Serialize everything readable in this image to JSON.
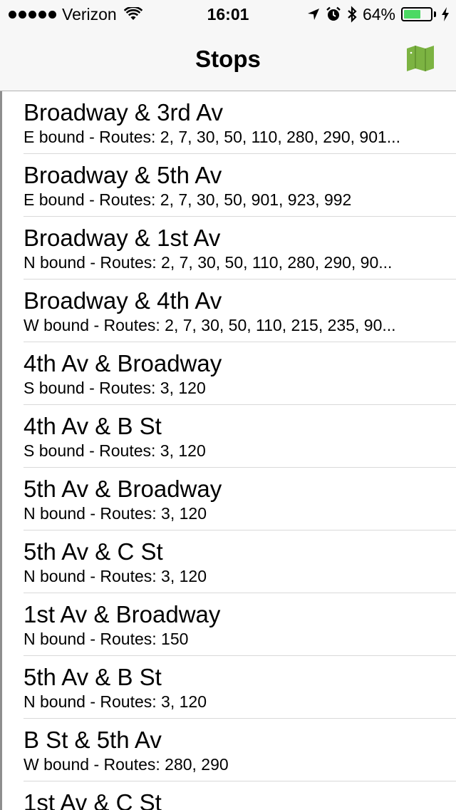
{
  "status_bar": {
    "carrier": "Verizon",
    "time": "16:01",
    "battery_percent_label": "64%",
    "battery_level": 0.64,
    "icons": [
      "signal-dots-icon",
      "wifi-icon",
      "location-arrow-icon",
      "alarm-icon",
      "bluetooth-icon",
      "battery-icon",
      "charging-bolt-icon"
    ]
  },
  "nav": {
    "title": "Stops",
    "map_button_icon": "map-icon",
    "accent_color": "#7cb342"
  },
  "stops": [
    {
      "name": "Broadway & 3rd Av",
      "detail": "E bound - Routes: 2, 7, 30, 50, 110, 280, 290, 901..."
    },
    {
      "name": "Broadway & 5th Av",
      "detail": "E bound - Routes: 2, 7, 30, 50, 901, 923, 992"
    },
    {
      "name": "Broadway & 1st Av",
      "detail": "N bound - Routes: 2, 7, 30, 50, 110, 280, 290, 90..."
    },
    {
      "name": "Broadway & 4th Av",
      "detail": "W bound - Routes: 2, 7, 30, 50, 110, 215, 235, 90..."
    },
    {
      "name": "4th Av & Broadway",
      "detail": "S bound - Routes: 3, 120"
    },
    {
      "name": "4th Av & B St",
      "detail": "S bound - Routes: 3, 120"
    },
    {
      "name": "5th Av & Broadway",
      "detail": "N bound - Routes: 3, 120"
    },
    {
      "name": "5th Av & C St",
      "detail": "N bound - Routes: 3, 120"
    },
    {
      "name": "1st Av & Broadway",
      "detail": "N bound - Routes: 150"
    },
    {
      "name": "5th Av & B St",
      "detail": "N bound - Routes: 3, 120"
    },
    {
      "name": "B St & 5th Av",
      "detail": "W bound - Routes: 280, 290"
    },
    {
      "name": "1st Av & C St",
      "detail": ""
    }
  ]
}
